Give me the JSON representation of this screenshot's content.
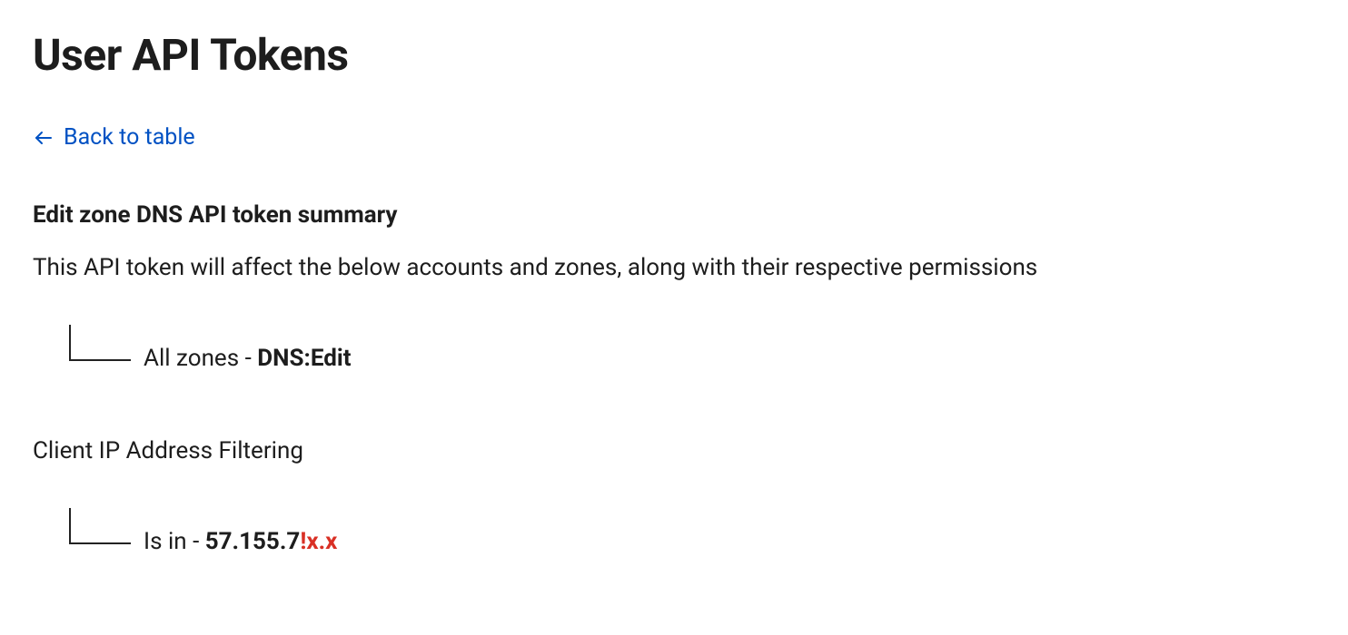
{
  "page": {
    "title": "User API Tokens"
  },
  "navigation": {
    "back_label": "Back to table"
  },
  "summary": {
    "title": "Edit zone DNS API token summary",
    "description": "This API token will affect the below accounts and zones, along with their respective permissions",
    "permission_scope": "All zones",
    "permission_separator": " - ",
    "permission_value": "DNS:Edit"
  },
  "ip_filtering": {
    "label": "Client IP Address Filtering",
    "condition": "Is in",
    "separator": " - ",
    "ip_prefix": "57.155.7",
    "ip_redacted": "!x.x"
  }
}
